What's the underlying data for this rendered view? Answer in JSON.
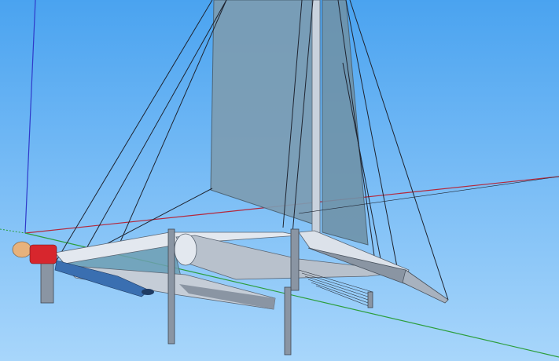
{
  "viewport": {
    "colors": {
      "sky_top": "#4aa3f0",
      "sky_bottom": "#a8d6fb",
      "axis_red": "#b5273a",
      "axis_green": "#2c9e3c",
      "axis_blue": "#2f39c9",
      "sail": "#7c9cb2",
      "sail_edge": "#4d6577",
      "hull_light": "#dce2ea",
      "hull_mid": "#b8c1cc",
      "hull_dark": "#8a95a3",
      "rigging": "#1f2430",
      "trampoline": "#6f9fb3",
      "figure_shirt": "#d7262d",
      "figure_skin": "#e7b27c",
      "figure_pants": "#3a6fb1"
    }
  }
}
